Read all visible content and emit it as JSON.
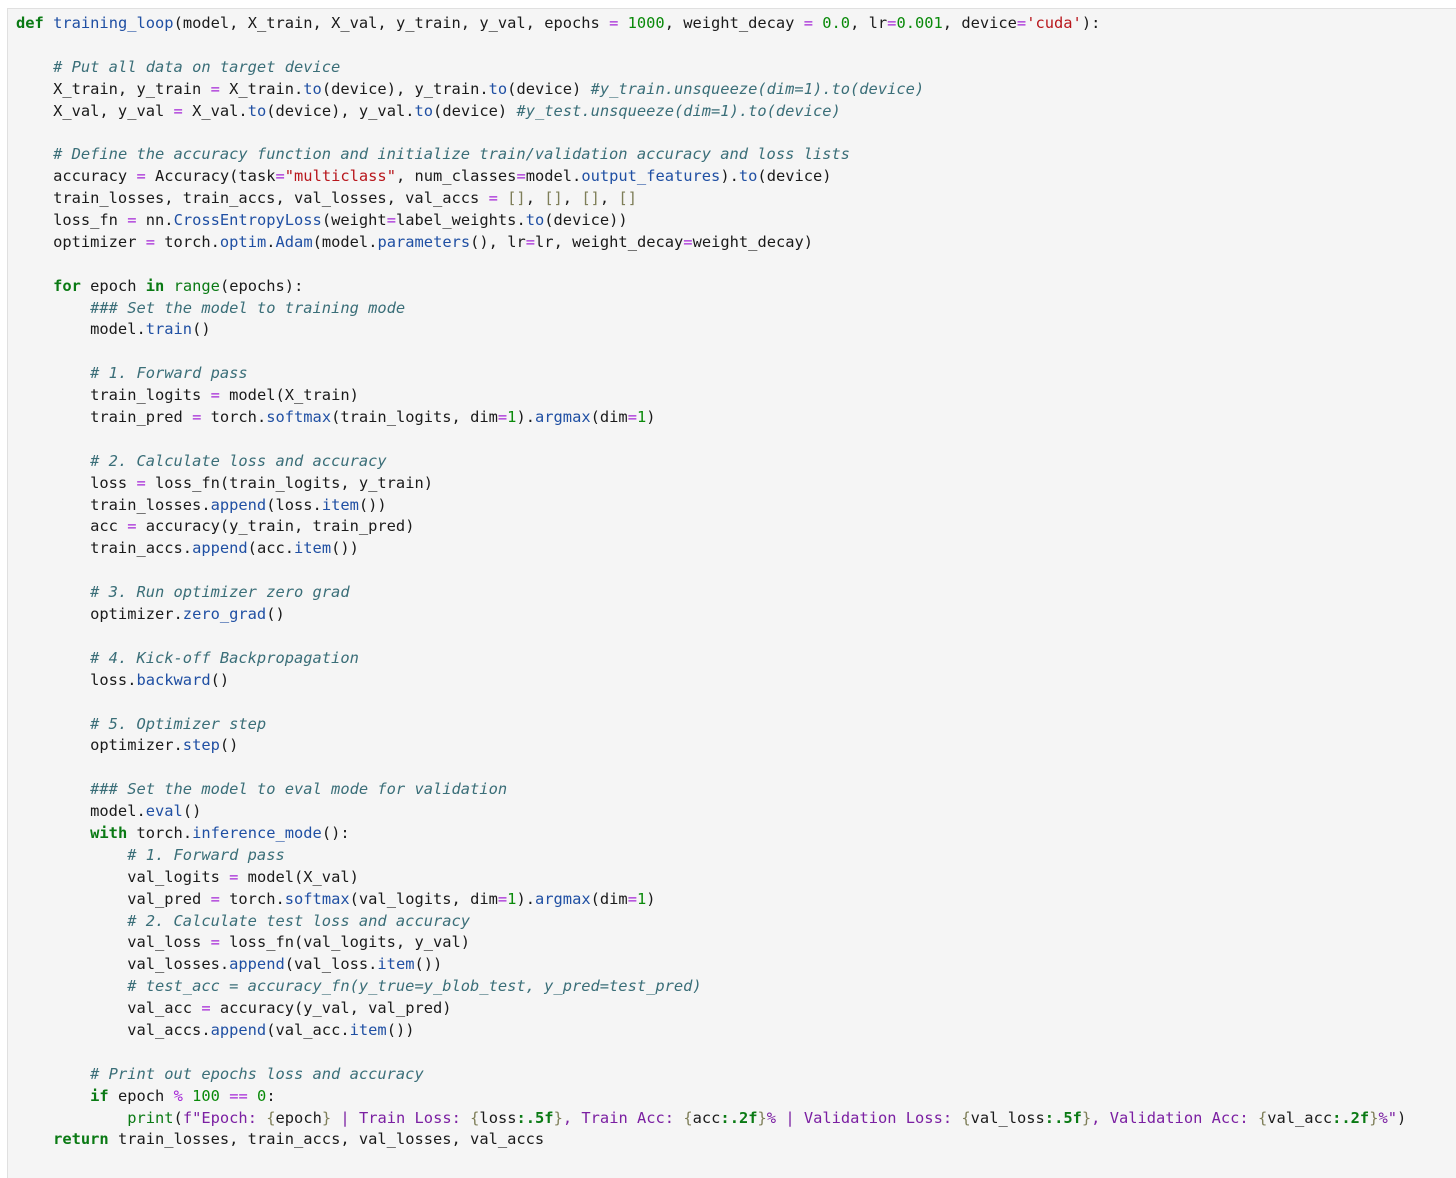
{
  "code": {
    "language": "python",
    "lines": [
      [
        [
          "kw",
          "def"
        ],
        [
          "t",
          " "
        ],
        [
          "fn",
          "training_loop"
        ],
        [
          "t",
          "(model, X_train, X_val, y_train, y_val, epochs "
        ],
        [
          "op",
          "="
        ],
        [
          "t",
          " "
        ],
        [
          "num",
          "1000"
        ],
        [
          "t",
          ", weight_decay "
        ],
        [
          "op",
          "="
        ],
        [
          "t",
          " "
        ],
        [
          "num",
          "0.0"
        ],
        [
          "t",
          ", lr"
        ],
        [
          "op",
          "="
        ],
        [
          "num",
          "0.001"
        ],
        [
          "t",
          ", device"
        ],
        [
          "op",
          "="
        ],
        [
          "str",
          "'cuda'"
        ],
        [
          "t",
          "):"
        ]
      ],
      [],
      [
        [
          "t",
          "    "
        ],
        [
          "cm",
          "# Put all data on target device"
        ]
      ],
      [
        [
          "t",
          "    X_train, y_train "
        ],
        [
          "op",
          "="
        ],
        [
          "t",
          " X_train."
        ],
        [
          "fn",
          "to"
        ],
        [
          "t",
          "(device), y_train."
        ],
        [
          "fn",
          "to"
        ],
        [
          "t",
          "(device) "
        ],
        [
          "cm",
          "#y_train.unsqueeze(dim=1).to(device)"
        ]
      ],
      [
        [
          "t",
          "    X_val, y_val "
        ],
        [
          "op",
          "="
        ],
        [
          "t",
          " X_val."
        ],
        [
          "fn",
          "to"
        ],
        [
          "t",
          "(device), y_val."
        ],
        [
          "fn",
          "to"
        ],
        [
          "t",
          "(device) "
        ],
        [
          "cm",
          "#y_test.unsqueeze(dim=1).to(device)"
        ]
      ],
      [],
      [
        [
          "t",
          "    "
        ],
        [
          "cm",
          "# Define the accuracy function and initialize train/validation accuracy and loss lists"
        ]
      ],
      [
        [
          "t",
          "    accuracy "
        ],
        [
          "op",
          "="
        ],
        [
          "t",
          " Accuracy(task"
        ],
        [
          "op",
          "="
        ],
        [
          "str",
          "\"multiclass\""
        ],
        [
          "t",
          ", num_classes"
        ],
        [
          "op",
          "="
        ],
        [
          "t",
          "model."
        ],
        [
          "fn",
          "output_features"
        ],
        [
          "t",
          ")."
        ],
        [
          "fn",
          "to"
        ],
        [
          "t",
          "(device)"
        ]
      ],
      [
        [
          "t",
          "    train_losses, train_accs, val_losses, val_accs "
        ],
        [
          "op",
          "="
        ],
        [
          "t",
          " "
        ],
        [
          "br",
          "[]"
        ],
        [
          "t",
          ", "
        ],
        [
          "br",
          "[]"
        ],
        [
          "t",
          ", "
        ],
        [
          "br",
          "[]"
        ],
        [
          "t",
          ", "
        ],
        [
          "br",
          "[]"
        ]
      ],
      [
        [
          "t",
          "    loss_fn "
        ],
        [
          "op",
          "="
        ],
        [
          "t",
          " nn."
        ],
        [
          "fn",
          "CrossEntropyLoss"
        ],
        [
          "t",
          "(weight"
        ],
        [
          "op",
          "="
        ],
        [
          "t",
          "label_weights."
        ],
        [
          "fn",
          "to"
        ],
        [
          "t",
          "(device))"
        ]
      ],
      [
        [
          "t",
          "    optimizer "
        ],
        [
          "op",
          "="
        ],
        [
          "t",
          " torch."
        ],
        [
          "fn",
          "optim"
        ],
        [
          "t",
          "."
        ],
        [
          "fn",
          "Adam"
        ],
        [
          "t",
          "(model."
        ],
        [
          "fn",
          "parameters"
        ],
        [
          "t",
          "(), lr"
        ],
        [
          "op",
          "="
        ],
        [
          "t",
          "lr, weight_decay"
        ],
        [
          "op",
          "="
        ],
        [
          "t",
          "weight_decay)"
        ]
      ],
      [],
      [
        [
          "t",
          "    "
        ],
        [
          "kw",
          "for"
        ],
        [
          "t",
          " epoch "
        ],
        [
          "kw",
          "in"
        ],
        [
          "t",
          " "
        ],
        [
          "bi",
          "range"
        ],
        [
          "t",
          "(epochs):"
        ]
      ],
      [
        [
          "t",
          "        "
        ],
        [
          "cm",
          "### Set the model to training mode"
        ]
      ],
      [
        [
          "t",
          "        model."
        ],
        [
          "fn",
          "train"
        ],
        [
          "t",
          "()"
        ]
      ],
      [],
      [
        [
          "t",
          "        "
        ],
        [
          "cm",
          "# 1. Forward pass"
        ]
      ],
      [
        [
          "t",
          "        train_logits "
        ],
        [
          "op",
          "="
        ],
        [
          "t",
          " model(X_train)"
        ]
      ],
      [
        [
          "t",
          "        train_pred "
        ],
        [
          "op",
          "="
        ],
        [
          "t",
          " torch."
        ],
        [
          "fn",
          "softmax"
        ],
        [
          "t",
          "(train_logits, dim"
        ],
        [
          "op",
          "="
        ],
        [
          "num",
          "1"
        ],
        [
          "t",
          ")."
        ],
        [
          "fn",
          "argmax"
        ],
        [
          "t",
          "(dim"
        ],
        [
          "op",
          "="
        ],
        [
          "num",
          "1"
        ],
        [
          "t",
          ")"
        ]
      ],
      [],
      [
        [
          "t",
          "        "
        ],
        [
          "cm",
          "# 2. Calculate loss and accuracy"
        ]
      ],
      [
        [
          "t",
          "        loss "
        ],
        [
          "op",
          "="
        ],
        [
          "t",
          " loss_fn(train_logits, y_train)"
        ]
      ],
      [
        [
          "t",
          "        train_losses."
        ],
        [
          "fn",
          "append"
        ],
        [
          "t",
          "(loss."
        ],
        [
          "fn",
          "item"
        ],
        [
          "t",
          "())"
        ]
      ],
      [
        [
          "t",
          "        acc "
        ],
        [
          "op",
          "="
        ],
        [
          "t",
          " accuracy(y_train, train_pred)"
        ]
      ],
      [
        [
          "t",
          "        train_accs."
        ],
        [
          "fn",
          "append"
        ],
        [
          "t",
          "(acc."
        ],
        [
          "fn",
          "item"
        ],
        [
          "t",
          "())"
        ]
      ],
      [],
      [
        [
          "t",
          "        "
        ],
        [
          "cm",
          "# 3. Run optimizer zero grad"
        ]
      ],
      [
        [
          "t",
          "        optimizer."
        ],
        [
          "fn",
          "zero_grad"
        ],
        [
          "t",
          "()"
        ]
      ],
      [],
      [
        [
          "t",
          "        "
        ],
        [
          "cm",
          "# 4. Kick-off Backpropagation"
        ]
      ],
      [
        [
          "t",
          "        loss."
        ],
        [
          "fn",
          "backward"
        ],
        [
          "t",
          "()"
        ]
      ],
      [],
      [
        [
          "t",
          "        "
        ],
        [
          "cm",
          "# 5. Optimizer step"
        ]
      ],
      [
        [
          "t",
          "        optimizer."
        ],
        [
          "fn",
          "step"
        ],
        [
          "t",
          "()"
        ]
      ],
      [],
      [
        [
          "t",
          "        "
        ],
        [
          "cm",
          "### Set the model to eval mode for validation"
        ]
      ],
      [
        [
          "t",
          "        model."
        ],
        [
          "fn",
          "eval"
        ],
        [
          "t",
          "()"
        ]
      ],
      [
        [
          "t",
          "        "
        ],
        [
          "kw",
          "with"
        ],
        [
          "t",
          " torch."
        ],
        [
          "fn",
          "inference_mode"
        ],
        [
          "t",
          "():"
        ]
      ],
      [
        [
          "t",
          "            "
        ],
        [
          "cm",
          "# 1. Forward pass"
        ]
      ],
      [
        [
          "t",
          "            val_logits "
        ],
        [
          "op",
          "="
        ],
        [
          "t",
          " model(X_val)"
        ]
      ],
      [
        [
          "t",
          "            val_pred "
        ],
        [
          "op",
          "="
        ],
        [
          "t",
          " torch."
        ],
        [
          "fn",
          "softmax"
        ],
        [
          "t",
          "(val_logits, dim"
        ],
        [
          "op",
          "="
        ],
        [
          "num",
          "1"
        ],
        [
          "t",
          ")."
        ],
        [
          "fn",
          "argmax"
        ],
        [
          "t",
          "(dim"
        ],
        [
          "op",
          "="
        ],
        [
          "num",
          "1"
        ],
        [
          "t",
          ")"
        ]
      ],
      [
        [
          "t",
          "            "
        ],
        [
          "cm",
          "# 2. Calculate test loss and accuracy"
        ]
      ],
      [
        [
          "t",
          "            val_loss "
        ],
        [
          "op",
          "="
        ],
        [
          "t",
          " loss_fn(val_logits, y_val)"
        ]
      ],
      [
        [
          "t",
          "            val_losses."
        ],
        [
          "fn",
          "append"
        ],
        [
          "t",
          "(val_loss."
        ],
        [
          "fn",
          "item"
        ],
        [
          "t",
          "())"
        ]
      ],
      [
        [
          "t",
          "            "
        ],
        [
          "cm",
          "# test_acc = accuracy_fn(y_true=y_blob_test, y_pred=test_pred)"
        ]
      ],
      [
        [
          "t",
          "            val_acc "
        ],
        [
          "op",
          "="
        ],
        [
          "t",
          " accuracy(y_val, val_pred)"
        ]
      ],
      [
        [
          "t",
          "            val_accs."
        ],
        [
          "fn",
          "append"
        ],
        [
          "t",
          "(val_acc."
        ],
        [
          "fn",
          "item"
        ],
        [
          "t",
          "())"
        ]
      ],
      [],
      [
        [
          "t",
          "        "
        ],
        [
          "cm",
          "# Print out epochs loss and accuracy"
        ]
      ],
      [
        [
          "t",
          "        "
        ],
        [
          "kw",
          "if"
        ],
        [
          "t",
          " epoch "
        ],
        [
          "op",
          "%"
        ],
        [
          "t",
          " "
        ],
        [
          "num",
          "100"
        ],
        [
          "t",
          " "
        ],
        [
          "op",
          "=="
        ],
        [
          "t",
          " "
        ],
        [
          "num",
          "0"
        ],
        [
          "t",
          ":"
        ]
      ],
      [
        [
          "t",
          "            "
        ],
        [
          "bi",
          "print"
        ],
        [
          "t",
          "("
        ],
        [
          "fs",
          "f\"Epoch: "
        ],
        [
          "br",
          "{"
        ],
        [
          "t",
          "epoch"
        ],
        [
          "br",
          "}"
        ],
        [
          "fs",
          " | Train Loss: "
        ],
        [
          "br",
          "{"
        ],
        [
          "t",
          "loss"
        ],
        [
          "fb",
          ":.5f"
        ],
        [
          "br",
          "}"
        ],
        [
          "fs",
          ", Train Acc: "
        ],
        [
          "br",
          "{"
        ],
        [
          "t",
          "acc"
        ],
        [
          "fb",
          ":.2f"
        ],
        [
          "br",
          "}"
        ],
        [
          "fs",
          "% | Validation Loss: "
        ],
        [
          "br",
          "{"
        ],
        [
          "t",
          "val_loss"
        ],
        [
          "fb",
          ":.5f"
        ],
        [
          "br",
          "}"
        ],
        [
          "fs",
          ", Validation Acc: "
        ],
        [
          "br",
          "{"
        ],
        [
          "t",
          "val_acc"
        ],
        [
          "fb",
          ":.2f"
        ],
        [
          "br",
          "}"
        ],
        [
          "fs",
          "%\""
        ],
        [
          "t",
          ")"
        ]
      ],
      [
        [
          "t",
          "    "
        ],
        [
          "kw",
          "return"
        ],
        [
          "t",
          " train_losses, train_accs, val_losses, val_accs"
        ]
      ]
    ]
  }
}
